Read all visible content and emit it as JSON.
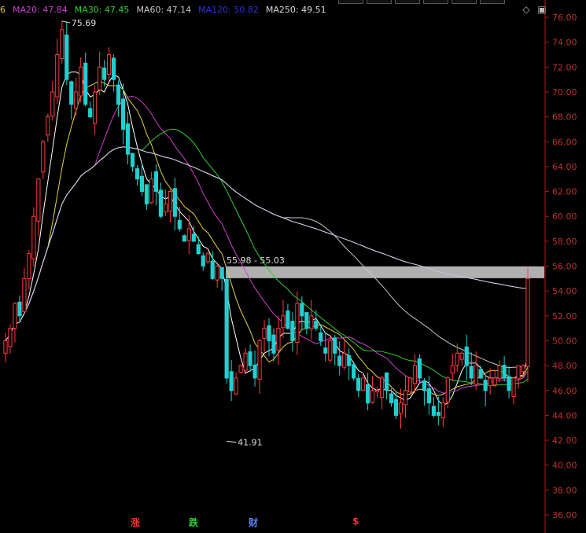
{
  "legend": [
    {
      "label": "6",
      "color": "#e8d040"
    },
    {
      "label": "MA20: 47.84",
      "color": "#d040d0"
    },
    {
      "label": "MA30: 47.45",
      "color": "#30d030"
    },
    {
      "label": "MA60: 47.14",
      "color": "#c8c8c8"
    },
    {
      "label": "MA120: 50.82",
      "color": "#3030e0"
    },
    {
      "label": "MA250: 49.51",
      "color": "#d8d8d8"
    }
  ],
  "annotations": {
    "high": "75.69",
    "low": "41.91",
    "zone": "55.98 - 55.03"
  },
  "events": [
    {
      "label": "涨",
      "color": "#ff3030"
    },
    {
      "label": "跌",
      "color": "#30d030"
    },
    {
      "label": "财",
      "color": "#6080ff"
    },
    {
      "label": "$",
      "color": "#ff3030"
    }
  ],
  "colors": {
    "up": "#ff3c3c",
    "down": "#20d0d0",
    "axis": "#b01818",
    "zone": "#b0b0b0"
  },
  "chart_data": {
    "type": "candlestick",
    "y_ticks": [
      "76.00",
      "74.00",
      "72.00",
      "70.00",
      "68.00",
      "66.00",
      "64.00",
      "62.00",
      "60.00",
      "58.00",
      "56.00",
      "54.00",
      "52.00",
      "50.00",
      "48.00",
      "46.00",
      "44.00",
      "42.00",
      "40.00",
      "38.00",
      "36.00"
    ],
    "ylim": [
      36,
      76
    ],
    "closes": [
      50,
      51,
      53,
      52,
      55,
      57,
      60,
      63,
      66,
      68,
      70,
      73,
      75,
      71,
      69,
      70,
      72,
      69,
      68,
      70,
      72,
      71,
      73,
      71,
      69,
      67,
      65,
      64,
      63,
      62,
      61,
      63,
      62,
      60,
      61,
      62,
      60,
      59,
      58,
      59,
      58,
      57,
      56,
      57,
      55,
      56,
      55,
      47,
      46,
      47,
      48,
      49,
      48,
      47,
      50,
      51,
      50,
      49,
      51,
      52,
      51,
      50,
      53,
      52,
      51,
      52,
      51,
      50,
      49,
      50,
      49,
      48,
      49,
      48,
      47,
      46,
      47,
      45,
      46,
      46,
      47,
      46,
      45,
      44,
      45,
      46,
      47,
      48,
      47,
      46,
      45,
      44,
      44,
      45,
      47,
      48,
      49,
      49,
      48,
      47,
      48,
      47,
      46,
      47,
      47,
      48,
      47,
      46,
      47,
      48,
      48,
      55
    ],
    "ma_series": [
      {
        "name": "MA20",
        "color": "#d040d0"
      },
      {
        "name": "MA30",
        "color": "#30d030"
      },
      {
        "name": "MA60",
        "color": "#c8c8c8"
      },
      {
        "name": "MA120",
        "color": "#3030e0"
      },
      {
        "name": "MA250",
        "color": "#d8d8d8"
      }
    ]
  }
}
